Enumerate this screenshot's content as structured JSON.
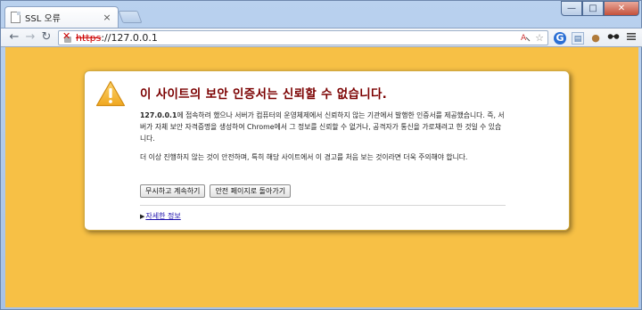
{
  "browser": {
    "tab": {
      "title": "SSL 오류",
      "close_symbol": "×"
    },
    "window_controls": {
      "minimize": "—",
      "maximize": "□",
      "close": "✕"
    },
    "nav": {
      "back": "←",
      "forward": "→",
      "reload": "↻"
    },
    "omnibox": {
      "scheme": "https",
      "separator": "://",
      "host": "127.0.0.1"
    },
    "toolbar_icons": [
      "translate-icon",
      "star-icon",
      "extension-blue-icon",
      "extension-note-icon",
      "cookie-icon",
      "incognito-glasses-icon",
      "menu-icon"
    ]
  },
  "interstitial": {
    "title": "이 사이트의 보안 인증서는 신뢰할 수 없습니다.",
    "para1_host": "127.0.0.1",
    "para1_rest": "에 접속하려 했으나 서버가 컴퓨터의 운영체제에서 신뢰하지 않는 기관에서 발행한 인증서를 제공했습니다. 즉, 서버가 자체 보안 자격증명을 생성하여 Chrome에서 그 정보를 신뢰할 수 없거나, 공격자가 통신을 가로채려고 한 것일 수 있습니다.",
    "para2": "더 이상 진행하지 않는 것이 안전하며, 특히 해당 사이트에서 이 경고를 처음 보는 것이라면 더욱 주의해야 합니다.",
    "proceed_button": "무시하고 계속하기",
    "back_button": "안전 페이지로 돌아가기",
    "details_link": "자세한 정보"
  },
  "colors": {
    "background": "#f7c045",
    "title": "#7b0000",
    "scheme_error": "#cc0000"
  }
}
